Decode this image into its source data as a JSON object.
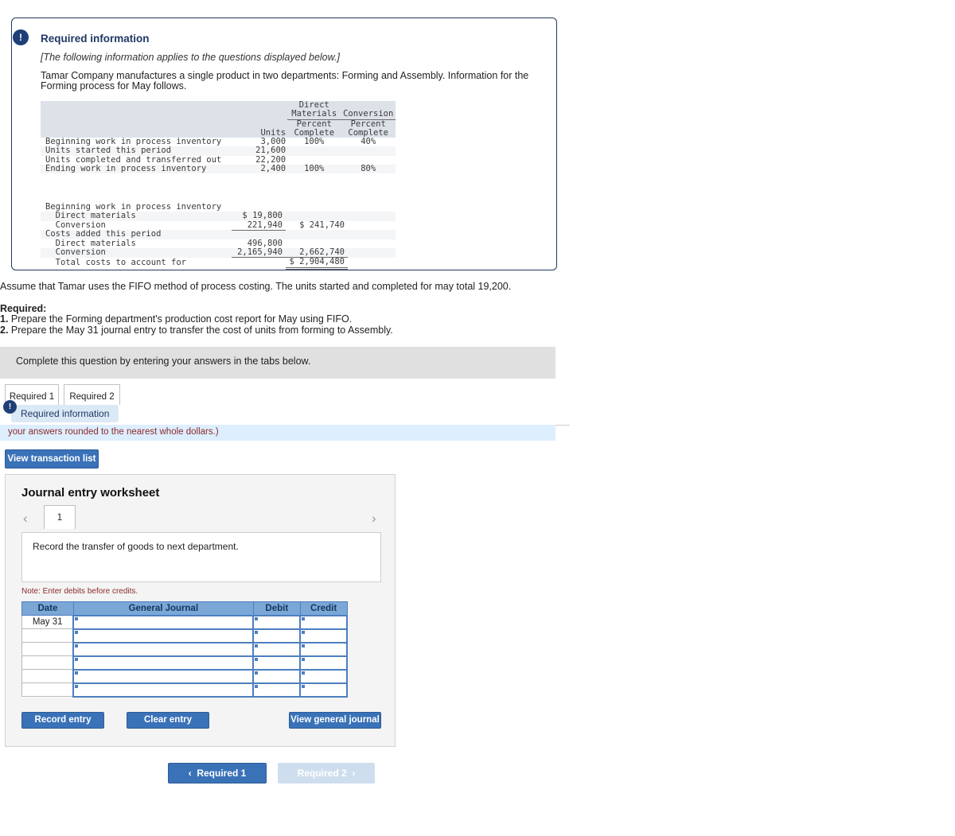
{
  "required_info": {
    "badge_icon": "exclamation-icon",
    "title": "Required information",
    "italic_note": "[The following information applies to the questions displayed below.]",
    "paragraph": "Tamar Company manufactures a single product in two departments: Forming and Assembly. Information for the Forming process for May follows.",
    "table": {
      "header": {
        "group_dm_line1": "Direct",
        "group_dm_line2": "Materials",
        "group_cv": "Conversion",
        "units": "Units",
        "dm_pct_line1": "Percent",
        "dm_pct_line2": "Complete",
        "cv_pct_line1": "Percent",
        "cv_pct_line2": "Complete"
      },
      "unit_rows": [
        {
          "label": "Beginning work in process inventory",
          "units": "3,000",
          "dm": "100%",
          "cv": "40%"
        },
        {
          "label": "Units started this period",
          "units": "21,600",
          "dm": "",
          "cv": ""
        },
        {
          "label": "Units completed and transferred out",
          "units": "22,200",
          "dm": "",
          "cv": ""
        },
        {
          "label": "Ending work in process inventory",
          "units": "2,400",
          "dm": "100%",
          "cv": "80%"
        }
      ],
      "cost_rows": [
        {
          "label": "Beginning work in process inventory",
          "a": "",
          "b": ""
        },
        {
          "label": "  Direct materials",
          "a": "$ 19,800",
          "b": ""
        },
        {
          "label": "  Conversion",
          "a": "221,940",
          "b": "$ 241,740"
        },
        {
          "label": "Costs added this period",
          "a": "",
          "b": ""
        },
        {
          "label": "  Direct materials",
          "a": "496,800",
          "b": ""
        },
        {
          "label": "  Conversion",
          "a": "2,165,940",
          "b": "2,662,740"
        },
        {
          "label": "  Total costs to account for",
          "a": "",
          "b": "$ 2,904,480"
        }
      ]
    }
  },
  "body": {
    "assume": "Assume that Tamar uses the FIFO method of process costing. The units started and completed for may total 19,200.",
    "required_heading": "Required:",
    "requirement_1_num": "1.",
    "requirement_1": "Prepare the Forming department's production cost report for May using FIFO.",
    "requirement_2_num": "2.",
    "requirement_2": "Prepare the May 31 journal entry to transfer the cost of units from forming to Assembly."
  },
  "instruction_bar": {
    "text": "Complete this question by entering your answers in the tabs below."
  },
  "tabs": [
    {
      "label": "Required 1"
    },
    {
      "label": "Required 2"
    }
  ],
  "floating_pill": {
    "badge_icon": "exclamation-icon",
    "label": "Required information"
  },
  "blue_banner": {
    "text": "your answers rounded to the nearest whole dollars.)"
  },
  "view_transaction_button": {
    "label": "View transaction list"
  },
  "worksheet": {
    "title": "Journal entry worksheet",
    "prev_icon": "chevron-left-icon",
    "next_icon": "chevron-right-icon",
    "page_tab": "1",
    "description": "Record the transfer of goods to next department.",
    "note": "Note: Enter debits before credits.",
    "table": {
      "columns": [
        "Date",
        "General Journal",
        "Debit",
        "Credit"
      ],
      "rows": [
        {
          "date": "May 31",
          "journal": "",
          "debit": "",
          "credit": ""
        },
        {
          "date": "",
          "journal": "",
          "debit": "",
          "credit": ""
        },
        {
          "date": "",
          "journal": "",
          "debit": "",
          "credit": ""
        },
        {
          "date": "",
          "journal": "",
          "debit": "",
          "credit": ""
        },
        {
          "date": "",
          "journal": "",
          "debit": "",
          "credit": ""
        },
        {
          "date": "",
          "journal": "",
          "debit": "",
          "credit": ""
        }
      ]
    },
    "buttons": {
      "record": "Record entry",
      "clear": "Clear entry",
      "view_general_journal": "View general journal"
    }
  },
  "bottom_nav": {
    "prev_icon": "chevron-left-icon",
    "prev_label": "Required 1",
    "next_label": "Required 2",
    "next_icon": "chevron-right-icon"
  },
  "colors": {
    "accent_blue": "#3a72b8",
    "box_border": "#1f3864",
    "badge_navy": "#1f3f77",
    "table_header": "#7ba7d7",
    "banner_blue": "#ddeeff",
    "note_red": "#8b2b2b",
    "disabled_blue": "#cfdeef"
  }
}
